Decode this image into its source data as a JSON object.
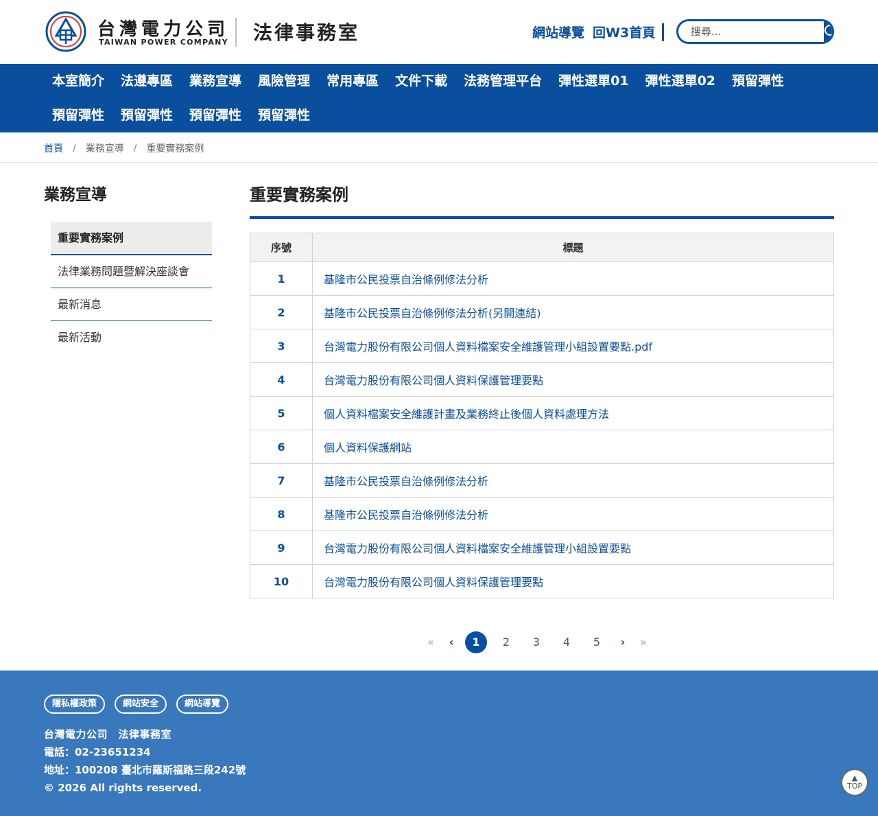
{
  "header": {
    "company_cn": "台灣電力公司",
    "company_en": "TAIWAN POWER COMPANY",
    "dept_title": "法律事務室",
    "util_links": [
      "網站導覽",
      "回W3首頁"
    ],
    "search_placeholder": "搜尋...",
    "brand_color": "#0a4f9e"
  },
  "nav": {
    "row1": [
      "本室簡介",
      "法遵專區",
      "業務宣導",
      "風險管理",
      "常用專區",
      "文件下載",
      "法務管理平台",
      "彈性選單01",
      "彈性選單02",
      "預留彈性"
    ],
    "row2": [
      "預留彈性",
      "預留彈性",
      "預留彈性",
      "預留彈性"
    ]
  },
  "breadcrumb": {
    "home": "首頁",
    "sep": "/",
    "section": "業務宣導",
    "current": "重要實務案例"
  },
  "sidebar": {
    "title": "業務宣導",
    "items": [
      {
        "label": "重要實務案例",
        "active": true
      },
      {
        "label": "法律業務問題暨解決座談會",
        "active": false
      },
      {
        "label": "最新消息",
        "active": false
      },
      {
        "label": "最新活動",
        "active": false
      }
    ]
  },
  "main": {
    "title": "重要實務案例",
    "table": {
      "headers": [
        "序號",
        "標題"
      ],
      "rows": [
        {
          "no": "1",
          "title": "基隆市公民投票自治條例修法分析"
        },
        {
          "no": "2",
          "title": "基隆市公民投票自治條例修法分析(另開連結)"
        },
        {
          "no": "3",
          "title": "台灣電力股份有限公司個人資料檔案安全維護管理小組設置要點.pdf"
        },
        {
          "no": "4",
          "title": "台灣電力股份有限公司個人資料保護管理要點"
        },
        {
          "no": "5",
          "title": "個人資料檔案安全維護計畫及業務終止後個人資料處理方法"
        },
        {
          "no": "6",
          "title": "個人資料保護網站"
        },
        {
          "no": "7",
          "title": "基隆市公民投票自治條例修法分析"
        },
        {
          "no": "8",
          "title": "基隆市公民投票自治條例修法分析"
        },
        {
          "no": "9",
          "title": "台灣電力股份有限公司個人資料檔案安全維護管理小組設置要點"
        },
        {
          "no": "10",
          "title": "台灣電力股份有限公司個人資料保護管理要點"
        }
      ]
    }
  },
  "pagination": {
    "first": "«",
    "prev": "‹",
    "pages": [
      "1",
      "2",
      "3",
      "4",
      "5"
    ],
    "current": "1",
    "next": "›",
    "last": "»"
  },
  "footer": {
    "links": [
      "隱私權政策",
      "網站安全",
      "網站導覽"
    ],
    "org": "台灣電力公司　法律事務室",
    "phone": "電話：02-23651234",
    "address": "地址：100208 臺北市羅斯福路三段242號",
    "copyright": "© 2026 All rights reserved.",
    "top_label": "TOP",
    "bg_color": "#3a78be"
  }
}
